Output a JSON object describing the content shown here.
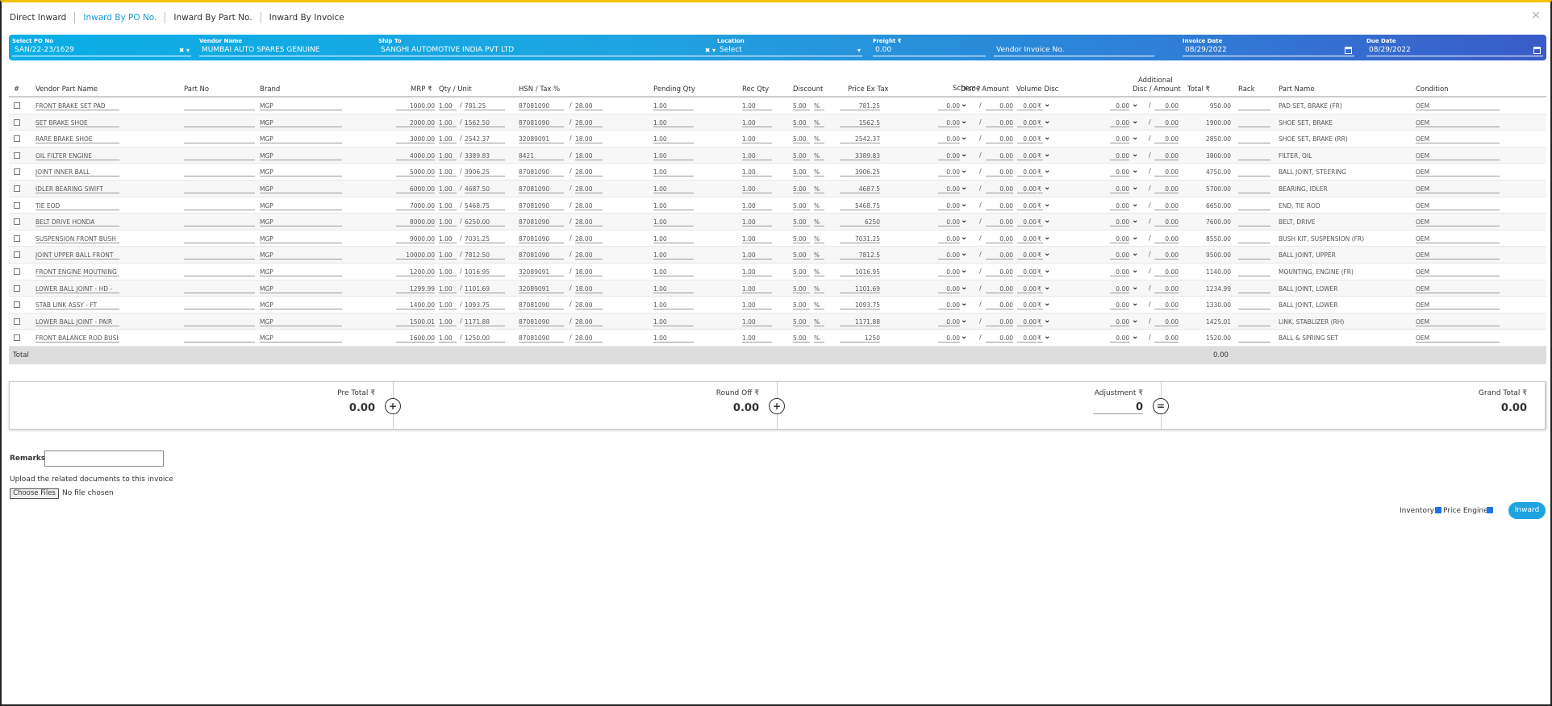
{
  "tabs": [
    {
      "label": "Direct Inward",
      "active": false
    },
    {
      "label": "Inward By PO No.",
      "active": true
    },
    {
      "label": "Inward By Part No.",
      "active": false
    },
    {
      "label": "Inward By Invoice",
      "active": false
    }
  ],
  "close": "×",
  "header": {
    "po": {
      "label": "Select PO No",
      "value": "SAN/22-23/1629"
    },
    "vendor": {
      "label": "Vendor Name",
      "value": "MUMBAI AUTO SPARES GENUINE"
    },
    "ship": {
      "label": "Ship To",
      "value": "SANGHI AUTOMOTIVE INDIA PVT LTD"
    },
    "location": {
      "label": "Location",
      "value": "Select"
    },
    "freight": {
      "label": "Freight ₹",
      "value": "0.00"
    },
    "vinv": {
      "label": "",
      "placeholder": "Vendor Invoice No."
    },
    "invdate": {
      "label": "Invoice Date",
      "value": "08/29/2022"
    },
    "duedate": {
      "label": "Due Date",
      "value": "08/29/2022"
    }
  },
  "columns": {
    "num": "#",
    "vpn": "Vendor Part Name",
    "partno": "Part No",
    "brand": "Brand",
    "mrp": "MRP ₹",
    "qty": "Qty / Unit",
    "hsn": "HSN / Tax %",
    "pend": "Pending Qty",
    "rec": "Rec Qty",
    "disc": "Discount",
    "pet": "Price Ex Tax",
    "scheme1": "Scheme",
    "scheme2": "Disc / Amount",
    "vol": "Volume Disc",
    "add1": "Additional",
    "add2": "Disc / Amount",
    "total": "Total ₹",
    "rack": "Rack",
    "pname": "Part Name",
    "cond": "Condition"
  },
  "rows": [
    {
      "vpn": "FRONT BRAKE SET PAD",
      "brand": "MGP",
      "mrp": "1000.00",
      "qty": "1.00",
      "unit": "781.25",
      "hsn": "87081090",
      "tax": "28.00",
      "pend": "1.00",
      "rec": "1.00",
      "disc": "5.00",
      "pct": "%",
      "pet": "781.25",
      "sd": "0.00",
      "sa": "0.00",
      "vd": "0.00",
      "vs": "₹",
      "ad": "0.00",
      "aa": "0.00",
      "total": "950.00",
      "pname": "PAD SET, BRAKE (FR)",
      "cond": "OEM"
    },
    {
      "vpn": "SET BRAKE SHOE",
      "brand": "MGP",
      "mrp": "2000.00",
      "qty": "1.00",
      "unit": "1562.50",
      "hsn": "87081090",
      "tax": "28.00",
      "pend": "1.00",
      "rec": "1.00",
      "disc": "5.00",
      "pct": "%",
      "pet": "1562.5",
      "sd": "0.00",
      "sa": "0.00",
      "vd": "0.00",
      "vs": "₹",
      "ad": "0.00",
      "aa": "0.00",
      "total": "1900.00",
      "pname": "SHOE SET, BRAKE",
      "cond": "OEM"
    },
    {
      "vpn": "RARE BRAKE SHOE",
      "brand": "MGP",
      "mrp": "3000.00",
      "qty": "1.00",
      "unit": "2542.37",
      "hsn": "32089091",
      "tax": "18.00",
      "pend": "1.00",
      "rec": "1.00",
      "disc": "5.00",
      "pct": "%",
      "pet": "2542.37",
      "sd": "0.00",
      "sa": "0.00",
      "vd": "0.00",
      "vs": "₹",
      "ad": "0.00",
      "aa": "0.00",
      "total": "2850.00",
      "pname": "SHOE SET, BRAKE (RR)",
      "cond": "OEM"
    },
    {
      "vpn": "OIL FILTER ENGINE",
      "brand": "MGP",
      "mrp": "4000.00",
      "qty": "1.00",
      "unit": "3389.83",
      "hsn": "8421",
      "tax": "18.00",
      "pend": "1.00",
      "rec": "1.00",
      "disc": "5.00",
      "pct": "%",
      "pet": "3389.83",
      "sd": "0.00",
      "sa": "0.00",
      "vd": "0.00",
      "vs": "₹",
      "ad": "0.00",
      "aa": "0.00",
      "total": "3800.00",
      "pname": "FILTER, OIL",
      "cond": "OEM"
    },
    {
      "vpn": "JOINT INNER BALL",
      "brand": "MGP",
      "mrp": "5000.00",
      "qty": "1.00",
      "unit": "3906.25",
      "hsn": "87081090",
      "tax": "28.00",
      "pend": "1.00",
      "rec": "1.00",
      "disc": "5.00",
      "pct": "%",
      "pet": "3906.25",
      "sd": "0.00",
      "sa": "0.00",
      "vd": "0.00",
      "vs": "₹",
      "ad": "0.00",
      "aa": "0.00",
      "total": "4750.00",
      "pname": "BALL JOINT, STEERING",
      "cond": "OEM"
    },
    {
      "vpn": "IDLER BEARING SWIFT",
      "brand": "MGP",
      "mrp": "6000.00",
      "qty": "1.00",
      "unit": "4687.50",
      "hsn": "87081090",
      "tax": "28.00",
      "pend": "1.00",
      "rec": "1.00",
      "disc": "5.00",
      "pct": "%",
      "pet": "4687.5",
      "sd": "0.00",
      "sa": "0.00",
      "vd": "0.00",
      "vs": "₹",
      "ad": "0.00",
      "aa": "0.00",
      "total": "5700.00",
      "pname": "BEARING, IDLER",
      "cond": "OEM"
    },
    {
      "vpn": "TIE EOD",
      "brand": "MGP",
      "mrp": "7000.00",
      "qty": "1.00",
      "unit": "5468.75",
      "hsn": "87081090",
      "tax": "28.00",
      "pend": "1.00",
      "rec": "1.00",
      "disc": "5.00",
      "pct": "%",
      "pet": "5468.75",
      "sd": "0.00",
      "sa": "0.00",
      "vd": "0.00",
      "vs": "₹",
      "ad": "0.00",
      "aa": "0.00",
      "total": "6650.00",
      "pname": "END, TIE ROD",
      "cond": "OEM"
    },
    {
      "vpn": "BELT DRIVE HONDA",
      "brand": "MGP",
      "mrp": "8000.00",
      "qty": "1.00",
      "unit": "6250.00",
      "hsn": "87081090",
      "tax": "28.00",
      "pend": "1.00",
      "rec": "1.00",
      "disc": "5.00",
      "pct": "%",
      "pet": "6250",
      "sd": "0.00",
      "sa": "0.00",
      "vd": "0.00",
      "vs": "₹",
      "ad": "0.00",
      "aa": "0.00",
      "total": "7600.00",
      "pname": "BELT, DRIVE",
      "cond": "OEM"
    },
    {
      "vpn": "SUSPENSION FRONT BUSH",
      "brand": "MGP",
      "mrp": "9000.00",
      "qty": "1.00",
      "unit": "7031.25",
      "hsn": "87081090",
      "tax": "28.00",
      "pend": "1.00",
      "rec": "1.00",
      "disc": "5.00",
      "pct": "%",
      "pet": "7031.25",
      "sd": "0.00",
      "sa": "0.00",
      "vd": "0.00",
      "vs": "₹",
      "ad": "0.00",
      "aa": "0.00",
      "total": "8550.00",
      "pname": "BUSH KIT, SUSPENSION (FR)",
      "cond": "OEM"
    },
    {
      "vpn": "JOINT UPPER BALL FRONT",
      "brand": "MGP",
      "mrp": "10000.00",
      "qty": "1.00",
      "unit": "7812.50",
      "hsn": "87081090",
      "tax": "28.00",
      "pend": "1.00",
      "rec": "1.00",
      "disc": "5.00",
      "pct": "%",
      "pet": "7812.5",
      "sd": "0.00",
      "sa": "0.00",
      "vd": "0.00",
      "vs": "₹",
      "ad": "0.00",
      "aa": "0.00",
      "total": "9500.00",
      "pname": "BALL JOINT, UPPER",
      "cond": "OEM"
    },
    {
      "vpn": "FRONT ENGINE MOUTNING",
      "brand": "MGP",
      "mrp": "1200.00",
      "qty": "1.00",
      "unit": "1016.95",
      "hsn": "32089091",
      "tax": "18.00",
      "pend": "1.00",
      "rec": "1.00",
      "disc": "5.00",
      "pct": "%",
      "pet": "1016.95",
      "sd": "0.00",
      "sa": "0.00",
      "vd": "0.00",
      "vs": "₹",
      "ad": "0.00",
      "aa": "0.00",
      "total": "1140.00",
      "pname": "MOUNTING, ENGINE (FR)",
      "cond": "OEM"
    },
    {
      "vpn": "LOWER BALL JOINT - HD -",
      "brand": "MGP",
      "mrp": "1299.99",
      "qty": "1.00",
      "unit": "1101.69",
      "hsn": "32089091",
      "tax": "18.00",
      "pend": "1.00",
      "rec": "1.00",
      "disc": "5.00",
      "pct": "%",
      "pet": "1101.69",
      "sd": "0.00",
      "sa": "0.00",
      "vd": "0.00",
      "vs": "₹",
      "ad": "0.00",
      "aa": "0.00",
      "total": "1234.99",
      "pname": "BALL JOINT, LOWER",
      "cond": "OEM"
    },
    {
      "vpn": "STAB LINK ASSY - FT",
      "brand": "MGP",
      "mrp": "1400.00",
      "qty": "1.00",
      "unit": "1093.75",
      "hsn": "87081090",
      "tax": "28.00",
      "pend": "1.00",
      "rec": "1.00",
      "disc": "5.00",
      "pct": "%",
      "pet": "1093.75",
      "sd": "0.00",
      "sa": "0.00",
      "vd": "0.00",
      "vs": "₹",
      "ad": "0.00",
      "aa": "0.00",
      "total": "1330.00",
      "pname": "BALL JOINT, LOWER",
      "cond": "OEM"
    },
    {
      "vpn": "LOWER BALL JOINT - PAIR",
      "brand": "MGP",
      "mrp": "1500.01",
      "qty": "1.00",
      "unit": "1171.88",
      "hsn": "87081090",
      "tax": "28.00",
      "pend": "1.00",
      "rec": "1.00",
      "disc": "5.00",
      "pct": "%",
      "pet": "1171.88",
      "sd": "0.00",
      "sa": "0.00",
      "vd": "0.00",
      "vs": "₹",
      "ad": "0.00",
      "aa": "0.00",
      "total": "1425.01",
      "pname": "LINK, STABLIZER (RH)",
      "cond": "OEM"
    },
    {
      "vpn": "FRONT BALANCE ROD BUSI",
      "brand": "MGP",
      "mrp": "1600.00",
      "qty": "1.00",
      "unit": "1250.00",
      "hsn": "87081090",
      "tax": "28.00",
      "pend": "1.00",
      "rec": "1.00",
      "disc": "5.00",
      "pct": "%",
      "pet": "1250",
      "sd": "0.00",
      "sa": "0.00",
      "vd": "0.00",
      "vs": "₹",
      "ad": "0.00",
      "aa": "0.00",
      "total": "1520.00",
      "pname": "BALL & SPRING SET",
      "cond": "OEM"
    }
  ],
  "total_row": {
    "label": "Total",
    "value": "0.00"
  },
  "summary": {
    "pre": {
      "label": "Pre Total ₹",
      "value": "0.00",
      "op": "+"
    },
    "round": {
      "label": "Round Off ₹",
      "value": "0.00",
      "op": "+"
    },
    "adj": {
      "label": "Adjustment ₹",
      "value": "0",
      "op": "="
    },
    "grand": {
      "label": "Grand Total ₹",
      "value": "0.00"
    }
  },
  "remarks_label": "Remarks",
  "upload_label": "Upload the related documents to this invoice",
  "choose_files": "Choose Files",
  "no_file": "No file chosen",
  "inventory_label": "Inventory",
  "price_engine_label": "Price Engine",
  "inward_button": "Inward"
}
